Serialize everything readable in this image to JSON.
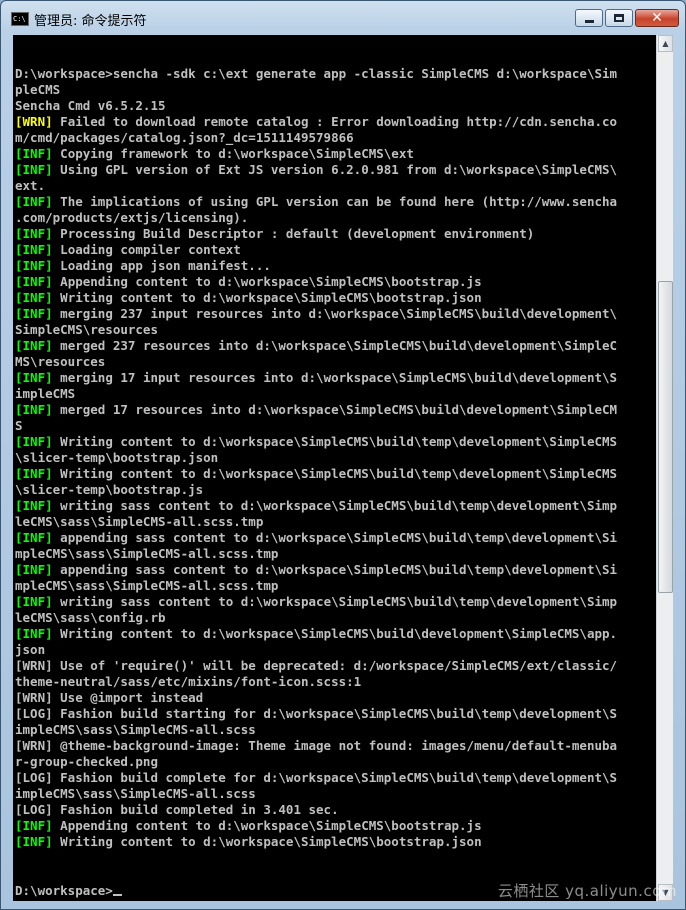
{
  "window": {
    "title": "管理员: 命令提示符",
    "icon_label": "C:\\",
    "minimize_icon": "minimize-icon",
    "maximize_icon": "maximize-icon",
    "close_icon": "close-icon",
    "close_glyph": "✕"
  },
  "console": {
    "lines": [
      {
        "tag": "",
        "text": "D:\\workspace>sencha -sdk c:\\ext generate app -classic SimpleCMS d:\\workspace\\Sim"
      },
      {
        "tag": "",
        "text": "pleCMS"
      },
      {
        "tag": "",
        "text": "Sencha Cmd v6.5.2.15"
      },
      {
        "tag": "[WRN]",
        "text": " Failed to download remote catalog : Error downloading http://cdn.sencha.co"
      },
      {
        "tag": "",
        "text": "m/cmd/packages/catalog.json?_dc=1511149579866"
      },
      {
        "tag": "[INF]",
        "text": " Copying framework to d:\\workspace\\SimpleCMS\\ext"
      },
      {
        "tag": "[INF]",
        "text": " Using GPL version of Ext JS version 6.2.0.981 from d:\\workspace\\SimpleCMS\\"
      },
      {
        "tag": "",
        "text": "ext."
      },
      {
        "tag": "[INF]",
        "text": " The implications of using GPL version can be found here (http://www.sencha"
      },
      {
        "tag": "",
        "text": ".com/products/extjs/licensing)."
      },
      {
        "tag": "[INF]",
        "text": " Processing Build Descriptor : default (development environment)"
      },
      {
        "tag": "[INF]",
        "text": " Loading compiler context"
      },
      {
        "tag": "[INF]",
        "text": " Loading app json manifest..."
      },
      {
        "tag": "[INF]",
        "text": " Appending content to d:\\workspace\\SimpleCMS\\bootstrap.js"
      },
      {
        "tag": "[INF]",
        "text": " Writing content to d:\\workspace\\SimpleCMS\\bootstrap.json"
      },
      {
        "tag": "[INF]",
        "text": " merging 237 input resources into d:\\workspace\\SimpleCMS\\build\\development\\"
      },
      {
        "tag": "",
        "text": "SimpleCMS\\resources"
      },
      {
        "tag": "[INF]",
        "text": " merged 237 resources into d:\\workspace\\SimpleCMS\\build\\development\\SimpleC"
      },
      {
        "tag": "",
        "text": "MS\\resources"
      },
      {
        "tag": "[INF]",
        "text": " merging 17 input resources into d:\\workspace\\SimpleCMS\\build\\development\\S"
      },
      {
        "tag": "",
        "text": "impleCMS"
      },
      {
        "tag": "[INF]",
        "text": " merged 17 resources into d:\\workspace\\SimpleCMS\\build\\development\\SimpleCM"
      },
      {
        "tag": "",
        "text": "S"
      },
      {
        "tag": "[INF]",
        "text": " Writing content to d:\\workspace\\SimpleCMS\\build\\temp\\development\\SimpleCMS"
      },
      {
        "tag": "",
        "text": "\\slicer-temp\\bootstrap.json"
      },
      {
        "tag": "[INF]",
        "text": " Writing content to d:\\workspace\\SimpleCMS\\build\\temp\\development\\SimpleCMS"
      },
      {
        "tag": "",
        "text": "\\slicer-temp\\bootstrap.js"
      },
      {
        "tag": "[INF]",
        "text": " writing sass content to d:\\workspace\\SimpleCMS\\build\\temp\\development\\Simp"
      },
      {
        "tag": "",
        "text": "leCMS\\sass\\SimpleCMS-all.scss.tmp"
      },
      {
        "tag": "[INF]",
        "text": " appending sass content to d:\\workspace\\SimpleCMS\\build\\temp\\development\\Si"
      },
      {
        "tag": "",
        "text": "mpleCMS\\sass\\SimpleCMS-all.scss.tmp"
      },
      {
        "tag": "[INF]",
        "text": " appending sass content to d:\\workspace\\SimpleCMS\\build\\temp\\development\\Si"
      },
      {
        "tag": "",
        "text": "mpleCMS\\sass\\SimpleCMS-all.scss.tmp"
      },
      {
        "tag": "[INF]",
        "text": " writing sass content to d:\\workspace\\SimpleCMS\\build\\temp\\development\\Simp"
      },
      {
        "tag": "",
        "text": "leCMS\\sass\\config.rb"
      },
      {
        "tag": "[INF]",
        "text": " Writing content to d:\\workspace\\SimpleCMS\\build\\development\\SimpleCMS\\app."
      },
      {
        "tag": "",
        "text": "json"
      },
      {
        "tag": "",
        "text": "[WRN] Use of 'require()' will be deprecated: d:/workspace/SimpleCMS/ext/classic/"
      },
      {
        "tag": "",
        "text": "theme-neutral/sass/etc/mixins/font-icon.scss:1"
      },
      {
        "tag": "",
        "text": "[WRN] Use @import instead"
      },
      {
        "tag": "",
        "text": "[LOG] Fashion build starting for d:\\workspace\\SimpleCMS\\build\\temp\\development\\S"
      },
      {
        "tag": "",
        "text": "impleCMS\\sass\\SimpleCMS-all.scss"
      },
      {
        "tag": "",
        "text": "[WRN] @theme-background-image: Theme image not found: images/menu/default-menuba"
      },
      {
        "tag": "",
        "text": "r-group-checked.png"
      },
      {
        "tag": "",
        "text": "[LOG] Fashion build complete for d:\\workspace\\SimpleCMS\\build\\temp\\development\\S"
      },
      {
        "tag": "",
        "text": "impleCMS\\sass\\SimpleCMS-all.scss"
      },
      {
        "tag": "",
        "text": "[LOG] Fashion build completed in 3.401 sec."
      },
      {
        "tag": "[INF]",
        "text": " Appending content to d:\\workspace\\SimpleCMS\\bootstrap.js"
      },
      {
        "tag": "[INF]",
        "text": " Writing content to d:\\workspace\\SimpleCMS\\bootstrap.json"
      }
    ],
    "prompt": "D:\\workspace>"
  },
  "scrollbar": {
    "up_icon": "scroll-up-arrow-icon",
    "down_icon": "scroll-down-arrow-icon",
    "up_glyph": "▲",
    "down_glyph": "▼"
  },
  "watermark": "云栖社区 yq.aliyun.com",
  "colors": {
    "console_bg": "#000000",
    "console_text": "#c0c0c0",
    "inf_tag": "#00ff00",
    "wrn_tag": "#ffff00",
    "close_button": "#c7432b"
  }
}
